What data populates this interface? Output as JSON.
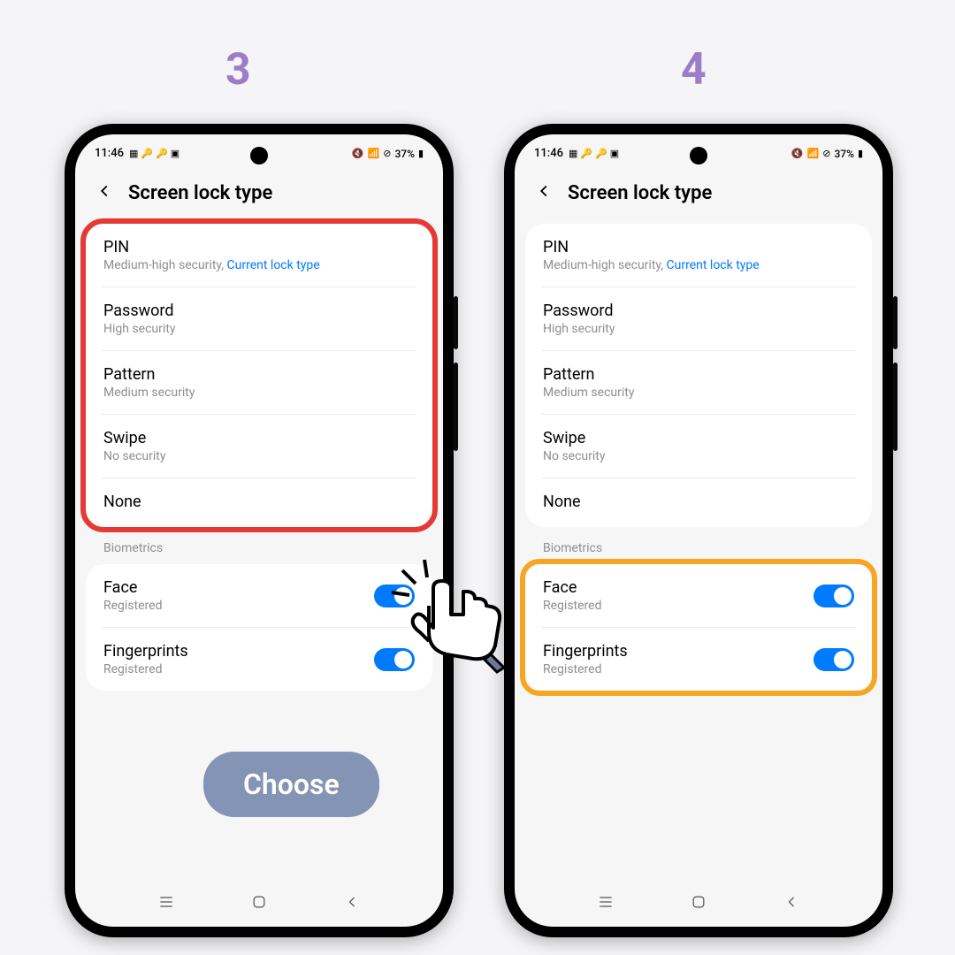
{
  "steps": {
    "left": "3",
    "right": "4"
  },
  "status": {
    "time": "11:46",
    "battery": "37%"
  },
  "header": {
    "title": "Screen lock type"
  },
  "lock_types": [
    {
      "title": "PIN",
      "subtitle": "Medium-high security, ",
      "current": "Current lock type"
    },
    {
      "title": "Password",
      "subtitle": "High security",
      "current": ""
    },
    {
      "title": "Pattern",
      "subtitle": "Medium security",
      "current": ""
    },
    {
      "title": "Swipe",
      "subtitle": "No security",
      "current": ""
    },
    {
      "title": "None",
      "subtitle": "",
      "current": ""
    }
  ],
  "biometrics_label": "Biometrics",
  "biometrics": [
    {
      "title": "Face",
      "subtitle": "Registered"
    },
    {
      "title": "Fingerprints",
      "subtitle": "Registered"
    }
  ],
  "annotation": {
    "choose": "Choose"
  }
}
